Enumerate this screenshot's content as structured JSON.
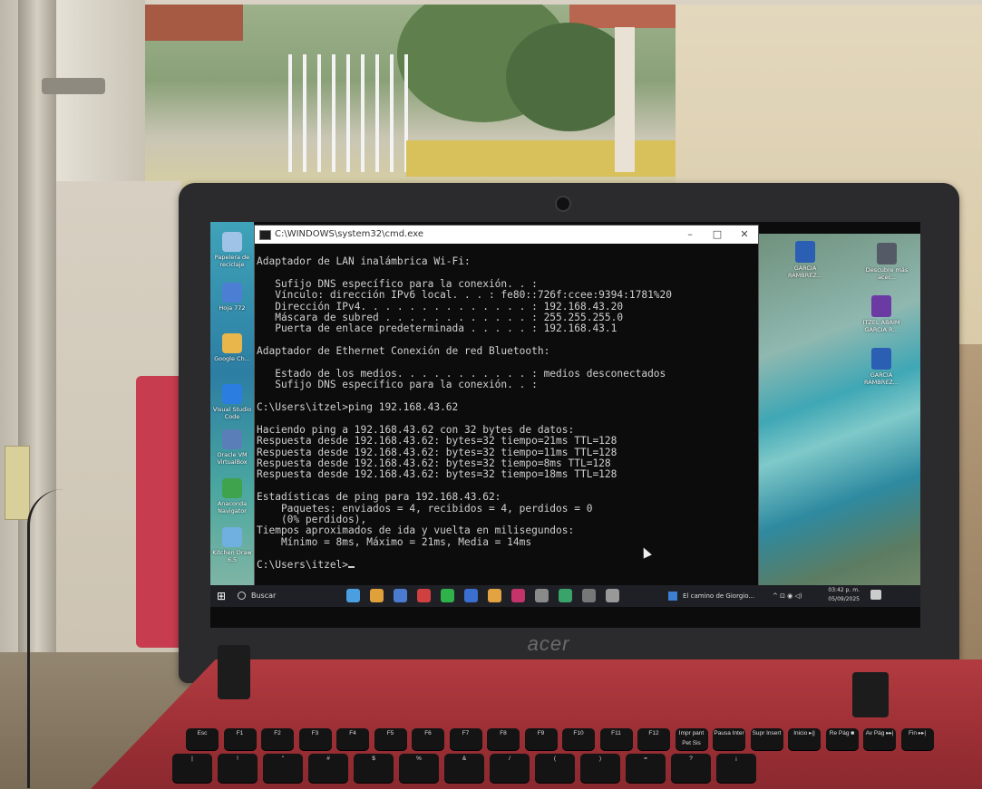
{
  "cmd_window": {
    "title": "C:\\WINDOWS\\system32\\cmd.exe",
    "min_glyph": "–",
    "max_glyph": "□",
    "close_glyph": "✕",
    "lines": [
      "Adaptador de LAN inalámbrica Wi-Fi:",
      "",
      "   Sufijo DNS específico para la conexión. . :",
      "   Vínculo: dirección IPv6 local. . . : fe80::726f:ccee:9394:1781%20",
      "   Dirección IPv4. . . . . . . . . . . . . . : 192.168.43.20",
      "   Máscara de subred . . . . . . . . . . . . : 255.255.255.0",
      "   Puerta de enlace predeterminada . . . . . : 192.168.43.1",
      "",
      "Adaptador de Ethernet Conexión de red Bluetooth:",
      "",
      "   Estado de los medios. . . . . . . . . . . : medios desconectados",
      "   Sufijo DNS específico para la conexión. . :",
      "",
      "C:\\Users\\itzel>ping 192.168.43.62",
      "",
      "Haciendo ping a 192.168.43.62 con 32 bytes de datos:",
      "Respuesta desde 192.168.43.62: bytes=32 tiempo=21ms TTL=128",
      "Respuesta desde 192.168.43.62: bytes=32 tiempo=11ms TTL=128",
      "Respuesta desde 192.168.43.62: bytes=32 tiempo=8ms TTL=128",
      "Respuesta desde 192.168.43.62: bytes=32 tiempo=18ms TTL=128",
      "",
      "Estadísticas de ping para 192.168.43.62:",
      "    Paquetes: enviados = 4, recibidos = 4, perdidos = 0",
      "    (0% perdidos),",
      "Tiempos aproximados de ida y vuelta en milisegundos:",
      "    Mínimo = 8ms, Máximo = 21ms, Media = 14ms",
      "",
      "C:\\Users\\itzel>"
    ]
  },
  "desktop_icons_left": [
    {
      "label": "Papelera de reciclaje",
      "color": "#9ec3e6"
    },
    {
      "label": "Hoja 772",
      "color": "#4c7fd4"
    },
    {
      "label": "Google Ch...",
      "color": "#e8b64a"
    },
    {
      "label": "Visual Studio Code",
      "color": "#2b7de0"
    },
    {
      "label": "Oracle VM VirtualBox",
      "color": "#5a7fb8"
    },
    {
      "label": "Anaconda Navigator",
      "color": "#3fa34d"
    },
    {
      "label": "Kitchen Draw 6.5",
      "color": "#6fb0e0"
    }
  ],
  "desktop_icons_right": [
    {
      "label": "GARCIA RAMBREZ...",
      "color": "#2b5fb4"
    },
    {
      "label": "Descubre más acer...",
      "color": "#555b66"
    },
    {
      "label": "ITZEL ABAIM GARCIA R...",
      "color": "#6c3aa3"
    },
    {
      "label": "GARCIA RAMBREZ...",
      "color": "#2b5fb4"
    }
  ],
  "taskbar": {
    "search_placeholder": "Buscar",
    "start_glyph": "⊞",
    "running_task": "El camino de Giorgio...",
    "tray_glyphs": "^ ⊡ ◉ ◁) ",
    "time": "03:42 p. m.",
    "date": "05/09/2025",
    "apps": [
      "#4a9fe0",
      "#e0a13a",
      "#4a7bd0",
      "#d04040",
      "#2fb24a",
      "#3a6fd0",
      "#e3a340",
      "#c4346a",
      "#8a8a8a",
      "#3aa36a",
      "#777",
      "#999"
    ]
  },
  "laptop_brand": "acer",
  "keyboard": {
    "row1": [
      "Esc",
      "F1",
      "F2",
      "F3",
      "F4",
      "F5",
      "F6",
      "F7",
      "F8",
      "F9",
      "F10",
      "F11",
      "F12",
      "Impr pant Pet Sis",
      "Pausa Inter",
      "Supr Insert",
      "Inicio ▸||",
      "Re Pág ■",
      "Av Pág ▸▸|",
      "Fin ▸▸|"
    ],
    "row2": [
      "|",
      "!",
      "\"",
      "#",
      "$",
      "%",
      "&",
      "/",
      "(",
      ")",
      "=",
      "?",
      "¡"
    ]
  }
}
